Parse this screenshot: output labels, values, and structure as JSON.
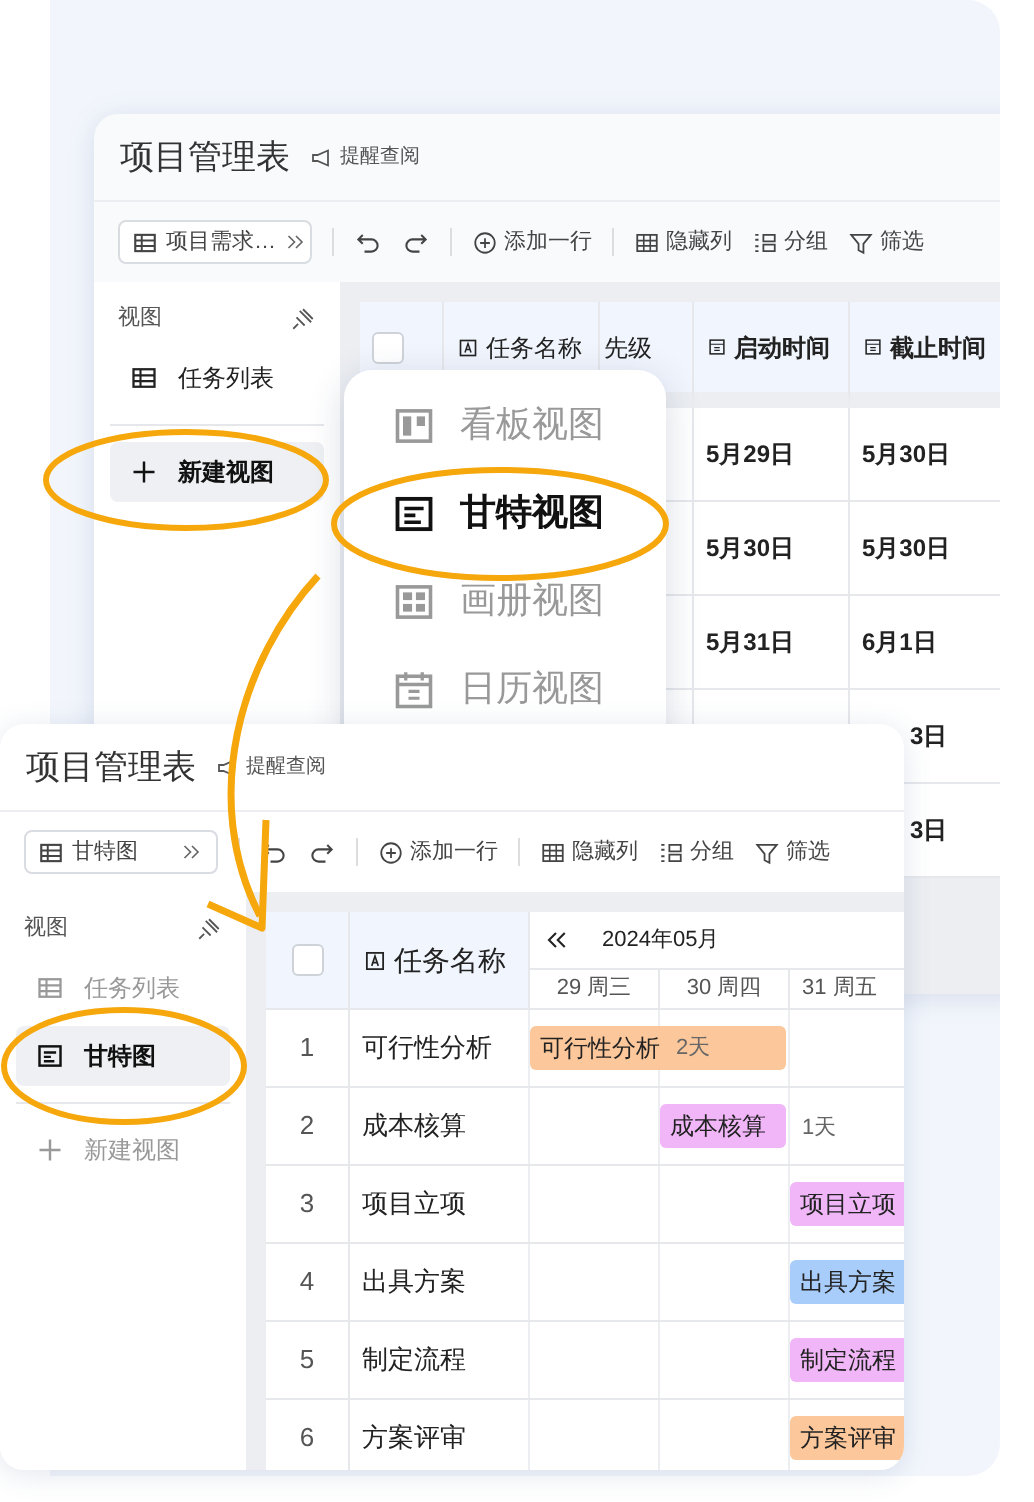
{
  "back_window": {
    "title": "项目管理表",
    "reminder": "提醒查阅",
    "view_select": "项目需求…",
    "toolbar": [
      {
        "kind": "undo"
      },
      {
        "kind": "redo"
      },
      {
        "kind": "add",
        "label": "添加一行"
      },
      {
        "kind": "hide",
        "label": "隐藏列"
      },
      {
        "kind": "group",
        "label": "分组"
      },
      {
        "kind": "filter",
        "label": "筛选"
      }
    ],
    "sidebar": {
      "heading": "视图",
      "views": [
        {
          "label": "任务列表",
          "kind": "table",
          "selected": false
        }
      ],
      "new_view": {
        "label": "新建视图",
        "highlighted": true
      }
    },
    "table": {
      "select_all": {
        "checked": false
      },
      "columns": [
        {
          "label": "任务名称",
          "kind": "text"
        },
        {
          "label": "先级",
          "kind": "plain"
        },
        {
          "label": "启动时间",
          "kind": "date"
        },
        {
          "label": "截止时间",
          "kind": "date"
        }
      ],
      "rows": [
        {
          "start": "5月29日",
          "end": "5月30日"
        },
        {
          "start": "5月30日",
          "end": "5月30日"
        },
        {
          "start": "5月31日",
          "end": "6月1日"
        },
        {
          "end": "3日"
        },
        {
          "end": "3日"
        }
      ]
    }
  },
  "view_menu": {
    "items": [
      {
        "label": "看板视图",
        "kind": "kanban",
        "selected": false
      },
      {
        "label": "甘特视图",
        "kind": "gantt",
        "selected": true
      },
      {
        "label": "画册视图",
        "kind": "gallery",
        "selected": false
      },
      {
        "label": "日历视图",
        "kind": "calendar",
        "selected": false
      }
    ]
  },
  "front_window": {
    "title": "项目管理表",
    "reminder": "提醒查阅",
    "view_select": "甘特图",
    "toolbar": [
      {
        "kind": "undo"
      },
      {
        "kind": "redo"
      },
      {
        "kind": "add",
        "label": "添加一行"
      },
      {
        "kind": "hide",
        "label": "隐藏列"
      },
      {
        "kind": "group",
        "label": "分组"
      },
      {
        "kind": "filter",
        "label": "筛选"
      }
    ],
    "sidebar": {
      "heading": "视图",
      "views": [
        {
          "label": "任务列表",
          "kind": "table",
          "selected": false
        },
        {
          "label": "甘特图",
          "kind": "gantt",
          "selected": true
        }
      ],
      "new_view": {
        "label": "新建视图",
        "highlighted": false
      }
    },
    "gantt": {
      "select_all": {
        "checked": false
      },
      "name_column": "任务名称",
      "month": "2024年05月",
      "days": [
        {
          "date": "29",
          "weekday": "周三"
        },
        {
          "date": "30",
          "weekday": "周四"
        },
        {
          "date": "31",
          "weekday": "周五"
        }
      ],
      "tasks": [
        {
          "index": "1",
          "name": "可行性分析",
          "bar": "可行性分析",
          "duration": "2天",
          "covers": [
            true,
            true,
            false
          ],
          "continues": false,
          "color": "#fcc89b"
        },
        {
          "index": "2",
          "name": "成本核算",
          "bar": "成本核算",
          "duration": "1天",
          "covers": [
            false,
            true,
            false
          ],
          "continues": false,
          "color": "#f0b6f8"
        },
        {
          "index": "3",
          "name": "项目立项",
          "bar": "项目立项",
          "covers": [
            false,
            false,
            true
          ],
          "continues": true,
          "color": "#f0b6f8"
        },
        {
          "index": "4",
          "name": "出具方案",
          "bar": "出具方案",
          "covers": [
            false,
            false,
            true
          ],
          "continues": true,
          "color": "#a9cdfa"
        },
        {
          "index": "5",
          "name": "制定流程",
          "bar": "制定流程",
          "covers": [
            false,
            false,
            true
          ],
          "continues": true,
          "color": "#f0b6f8"
        },
        {
          "index": "6",
          "name": "方案评审",
          "bar": "方案评审",
          "covers": [
            false,
            false,
            true
          ],
          "continues": true,
          "color": "#fcc89b"
        }
      ]
    }
  }
}
